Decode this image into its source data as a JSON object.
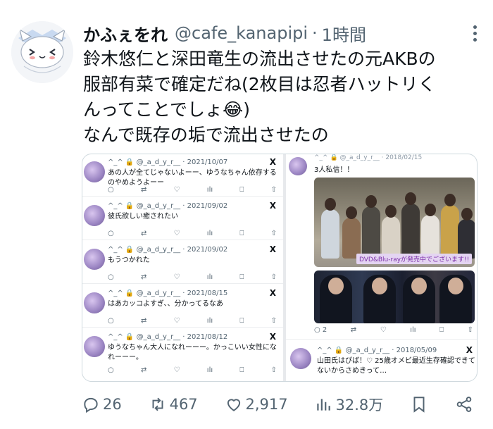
{
  "tweet": {
    "display_name": "かふぇをれ",
    "handle": "@cafe_kanapipi",
    "separator": "·",
    "time": "1時間",
    "lines": [
      "鈴木悠仁と深田竜生の流出させたの元AKBの",
      "服部有菜で確定だね(2枚目は忍者ハットリく",
      "んってことでしょ😂)",
      "なんで既存の垢で流出させたの"
    ]
  },
  "embedded_left": {
    "tweets": [
      {
        "meta": "^_^ 🔒 @_a_d_y_r__ · 2021/10/07",
        "text": "あの人が全てじゃないよーー、ゆうなちゃん依存するのやめようよーー"
      },
      {
        "meta": "^_^ 🔒 @_a_d_y_r__ · 2021/09/02",
        "text": "彼氏欲しい癒されたい"
      },
      {
        "meta": "^_^ 🔒 @_a_d_y_r__ · 2021/09/02",
        "text": "もうつかれた"
      },
      {
        "meta": "^_^ 🔒 @_a_d_y_r__ · 2021/08/15",
        "text": "はあカッコよすぎ、、分かってるなあ"
      },
      {
        "meta": "^_^ 🔒 @_a_d_y_r__ · 2021/08/12",
        "text": "ゆうなちゃん大人になれーーー。かっこいい女性になれーーー。"
      }
    ],
    "x_label": "X"
  },
  "embedded_right": {
    "meta": "^_^ 🔒 @_a_d_y_r__ · 2018/02/15",
    "text": "3人私信！！",
    "caption": "DVD&Blu-rayが発売中でございます!!",
    "reply_count": "2",
    "second": {
      "meta": "^_^ 🔒 @_a_d_y_r__ · 2018/05/09",
      "text": "山田氏はぴば！♡ 25歳オメビ最近生存確認できてないからさめきって…"
    }
  },
  "actions": {
    "replies": "26",
    "retweets": "467",
    "likes": "2,917",
    "views": "32.8万"
  },
  "colors": {
    "text": "#0f1419",
    "muted": "#536471"
  }
}
